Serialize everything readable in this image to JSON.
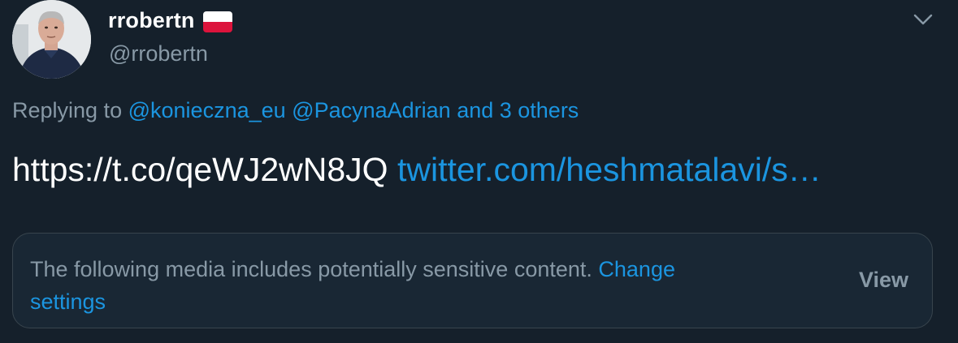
{
  "author": {
    "display_name": "rrobertn",
    "handle": "@rrobertn",
    "flag": "poland-flag"
  },
  "reply": {
    "prefix": "Replying to",
    "mention_1": "@konieczna_eu",
    "mention_2": "@PacynaAdrian",
    "others": "and 3 others"
  },
  "tweet": {
    "short_link": "https://t.co/qeWJ2wN8JQ",
    "quoted_link": "twitter.com/heshmatalavi/s…"
  },
  "sensitive_notice": {
    "text": "The following media includes potentially sensitive content.",
    "change_word": "Change",
    "settings_word": "settings",
    "view_label": "View"
  },
  "colors": {
    "background": "#15202b",
    "card_background": "#192734",
    "accent": "#1b95e0",
    "secondary_text": "#8899a6"
  },
  "icons": {
    "menu": "chevron-down-icon"
  }
}
